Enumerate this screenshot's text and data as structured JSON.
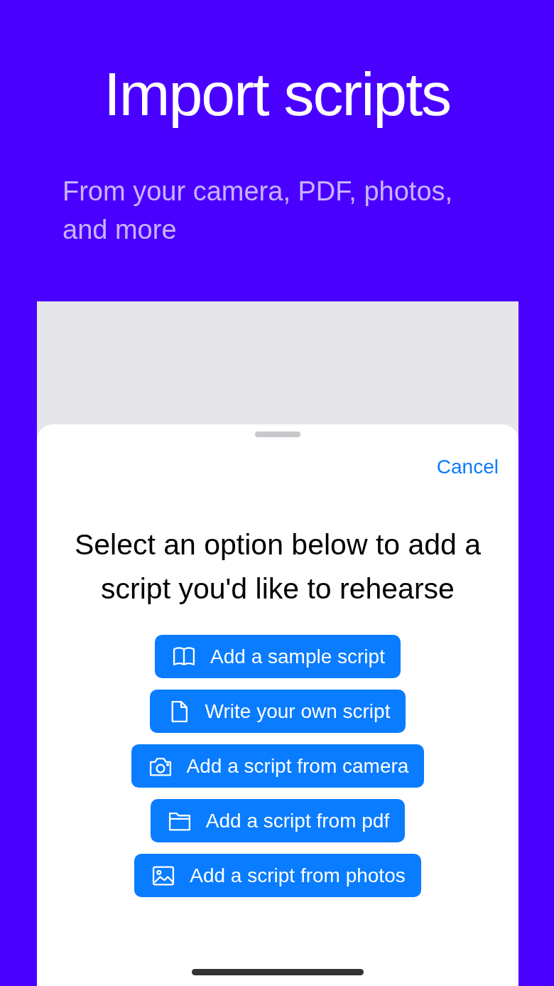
{
  "headline": "Import scripts",
  "subtitle": "From your camera, PDF, photos, and more",
  "sheet": {
    "cancel": "Cancel",
    "prompt": "Select an option below to add a script you'd like to rehearse",
    "options": [
      {
        "label": "Add a sample script"
      },
      {
        "label": "Write your own script"
      },
      {
        "label": "Add a script from camera"
      },
      {
        "label": "Add a script from pdf"
      },
      {
        "label": "Add a script from photos"
      }
    ]
  }
}
